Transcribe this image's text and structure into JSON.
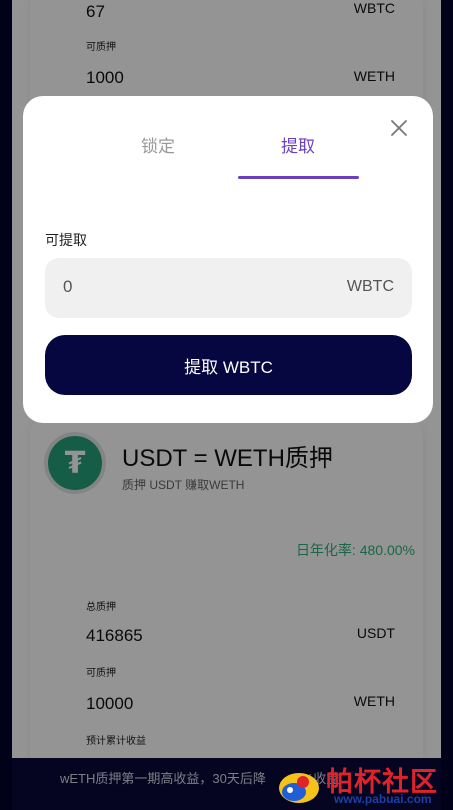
{
  "background_stake": {
    "rows": [
      {
        "value": "67",
        "unit": "WBTC"
      },
      {
        "label": "可质押",
        "value": "1000",
        "unit": "WETH"
      }
    ]
  },
  "pool": {
    "icon": "tether-icon",
    "title": "USDT = WETH质押",
    "subtitle": "质押 USDT 赚取WETH",
    "apy": "日年化率: 480.00%",
    "total_stake_label": "总质押",
    "total_stake_value": "416865",
    "total_stake_unit": "USDT",
    "available_label": "可质押",
    "available_value": "10000",
    "available_unit": "WETH",
    "estimated_label": "预计累计收益"
  },
  "banner": {
    "text": "wETH质押第一期高收益，30天后降",
    "partial_text": "%收益"
  },
  "watermark": {
    "title": "帕杯社区",
    "url": "www.pabuai.com"
  },
  "modal": {
    "tabs": [
      {
        "label": "锁定",
        "active": false
      },
      {
        "label": "提取",
        "active": true
      }
    ],
    "field_label": "可提取",
    "amount_value": "0",
    "amount_unit": "WBTC",
    "submit_label": "提取 WBTC"
  },
  "colors": {
    "accent": "#6a40c0",
    "button": "#060640",
    "frame": "#02022e",
    "apy": "#2bb17a",
    "tether": "#26a17b"
  }
}
